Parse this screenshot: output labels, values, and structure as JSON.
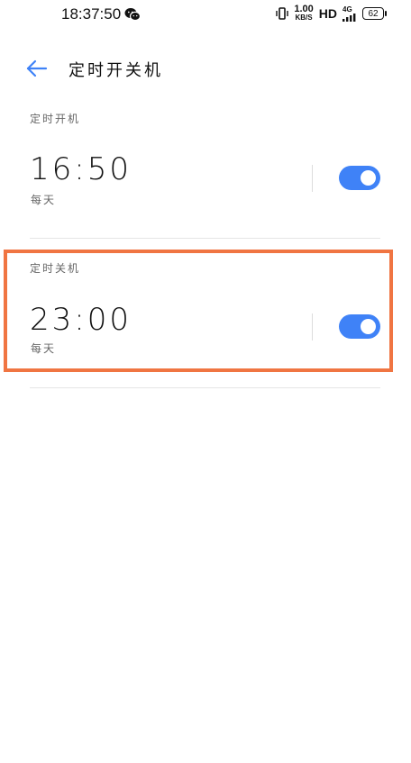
{
  "status_bar": {
    "time": "18:37:50",
    "net_speed_value": "1.00",
    "net_speed_unit": "KB/S",
    "hd": "HD",
    "network": "4G",
    "battery": "62"
  },
  "header": {
    "title": "定时开关机"
  },
  "schedules": [
    {
      "section_label": "定时开机",
      "time": "16:50",
      "repeat": "每天",
      "enabled": true
    },
    {
      "section_label": "定时关机",
      "time": "23:00",
      "repeat": "每天",
      "enabled": true
    }
  ],
  "colors": {
    "accent": "#3f82f7",
    "highlight": "#f07542"
  }
}
